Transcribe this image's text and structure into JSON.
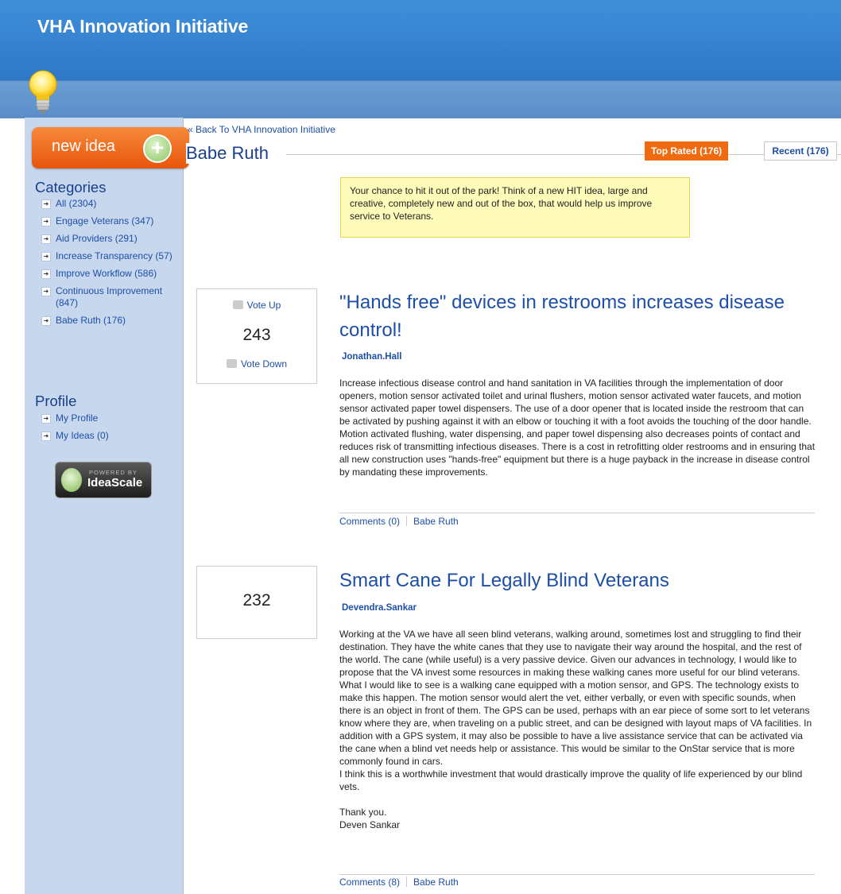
{
  "header": {
    "title": "VHA Innovation Initiative"
  },
  "sidebar": {
    "new_idea_label": "new idea",
    "new_idea_plus": "+",
    "categories_heading": "Categories",
    "categories": [
      {
        "label": "All (2304)"
      },
      {
        "label": "Engage Veterans (347)"
      },
      {
        "label": "Aid Providers (291)"
      },
      {
        "label": "Increase Transparency (57)"
      },
      {
        "label": "Improve Workflow (586)"
      },
      {
        "label": "Continuous Improvement (847)"
      },
      {
        "label": "Babe Ruth (176)"
      }
    ],
    "profile_heading": "Profile",
    "profile_links": [
      {
        "label": "My Profile"
      },
      {
        "label": "My Ideas (0)"
      }
    ],
    "badge_powered": "POWERED BY",
    "badge_name": "IdeaScale"
  },
  "main": {
    "back_link": "« Back To VHA Innovation Initiative",
    "page_title": "Babe Ruth",
    "tabs": {
      "top_rated": "Top Rated (176)",
      "recent": "Recent (176)"
    },
    "notice": "Your chance to hit it out of the park! Think of a new HIT idea, large and creative, completely new and out of the box, that would help us improve service to Veterans."
  },
  "ideas": [
    {
      "vote_up": "Vote Up",
      "vote_count": "243",
      "vote_down": "Vote Down",
      "title": "\"Hands free\" devices in restrooms increases disease control!",
      "author": "Jonathan.Hall",
      "body": "Increase infectious disease control and hand sanitation in VA facilities through the implementation of door openers, motion sensor activated toilet and urinal flushers, motion sensor activated water faucets, and motion sensor activated paper towel dispensers. The use of a door opener that is located inside the restroom that can be activated by pushing against it with an elbow or touching it with a foot avoids the touching of the door handle. Motion activated flushing, water dispensing, and paper towel dispensing also decreases points of contact and reduces risk of transmitting infectious diseases. There is a cost in retrofitting older restrooms and in ensuring that all new construction uses \"hands-free\" equipment but there is a huge payback in the increase in disease control by mandating these improvements.",
      "comments": "Comments (0)",
      "category": "Babe Ruth"
    },
    {
      "vote_count": "232",
      "title": "Smart Cane For Legally Blind Veterans",
      "author": "Devendra.Sankar",
      "body_main": "Working at the VA we have all seen blind veterans, walking around, sometimes lost and struggling to find their destination. They have the white canes that they use to navigate their way around the hospital, and the rest of the world. The cane (while useful) is a very passive device. Given our advances in technology, I would like to propose that the VA invest some resources in making these walking canes more useful for our blind veterans. What I would like to see is a walking cane equipped with a motion sensor, and GPS. The technology exists to make this happen. The motion sensor would alert the vet, either verbally, or even with specific sounds, when there is an object in front of them. The GPS can be used, perhaps with an ear piece of some sort to let veterans know where they are, when traveling on a public street, and can be designed with layout maps of VA facilities. In addition with a GPS system, it may also be possible to have a live assistance service that can be activated via the cane when a blind vet needs help or assistance. This would be similar to the OnStar service that is more commonly found in cars.",
      "body_second": "I think this is a worthwhile investment that would drastically improve the quality of life experienced by our blind vets.",
      "body_thanks": "Thank you.",
      "body_sign": "Deven Sankar",
      "comments": "Comments (8)",
      "category": "Babe Ruth"
    }
  ]
}
